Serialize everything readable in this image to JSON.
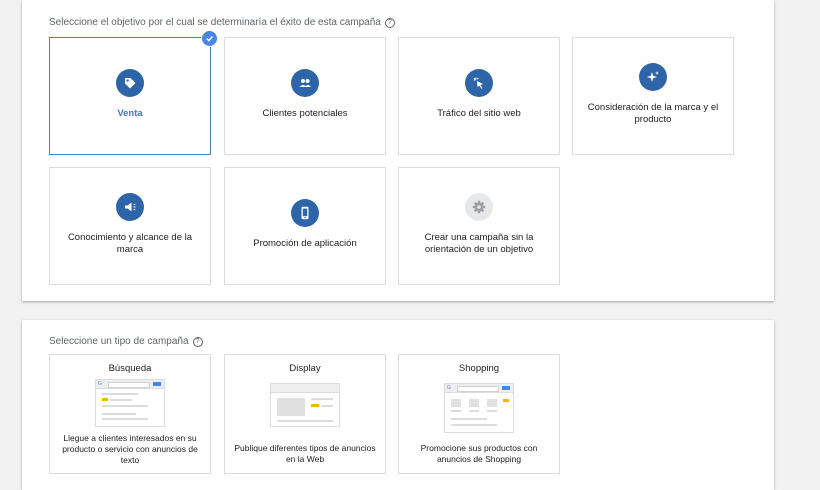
{
  "objectives_section": {
    "title": "Seleccione el objetivo por el cual se determinaría el éxito de esta campaña",
    "help_icon": "?",
    "cards": [
      {
        "label": "Venta",
        "icon": "tag-icon",
        "selected": true
      },
      {
        "label": "Clientes potenciales",
        "icon": "people-icon",
        "selected": false
      },
      {
        "label": "Tráfico del sitio web",
        "icon": "cursor-click-icon",
        "selected": false
      },
      {
        "label": "Consideración de la marca y el producto",
        "icon": "sparkle-icon",
        "selected": false
      },
      {
        "label": "Conocimiento y alcance de la marca",
        "icon": "megaphone-icon",
        "selected": false
      },
      {
        "label": "Promoción de aplicación",
        "icon": "phone-icon",
        "selected": false
      },
      {
        "label": "Crear una campaña sin la orientación de un objetivo",
        "icon": "gear-icon",
        "selected": false
      }
    ]
  },
  "campaign_section": {
    "title": "Seleccione un tipo de campaña",
    "help_icon": "?",
    "cards": [
      {
        "title": "Búsqueda",
        "description": "Llegue a clientes interesados en su producto o servicio con anuncios de texto"
      },
      {
        "title": "Display",
        "description": "Publique diferentes tipos de anuncios en la Web"
      },
      {
        "title": "Shopping",
        "description": "Promocione sus productos con anuncios de Shopping"
      }
    ]
  },
  "colors": {
    "accent": "#2d65a8",
    "selected_border": "#4a7fc1",
    "check": "#4a86e8",
    "ad_highlight": "#f4b400"
  }
}
